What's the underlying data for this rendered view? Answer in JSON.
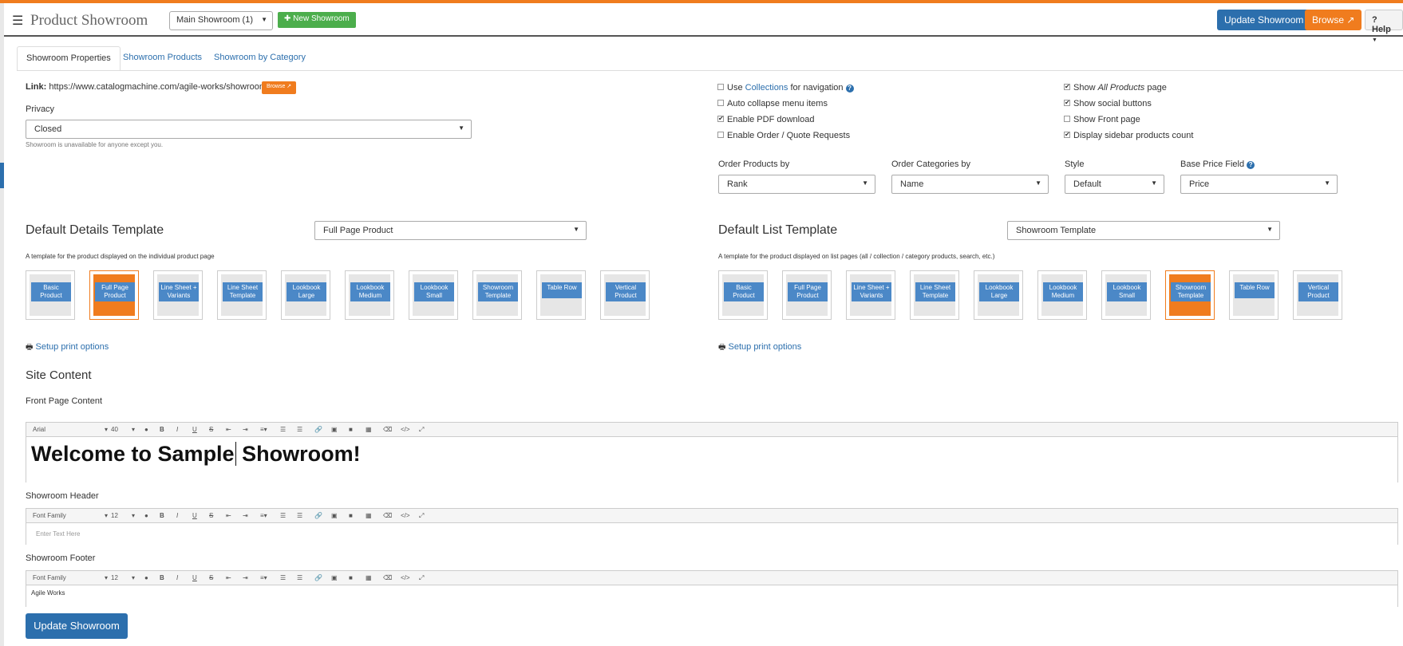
{
  "navbar": {
    "brand": "Product Showroom",
    "showroom_select": "Main Showroom (1)",
    "new_button": "New Showroom",
    "update_button": "Update Showroom",
    "browse_button": "Browse",
    "help_button": "Help"
  },
  "tabs": [
    "Showroom Properties",
    "Showroom Products",
    "Showroom by Category"
  ],
  "link": {
    "label": "Link:",
    "url": "https://www.catalogmachine.com/agile-works/showroom/",
    "browse": "Browse"
  },
  "privacy": {
    "label": "Privacy",
    "value": "Closed",
    "help": "Showroom is unavailable for anyone except you."
  },
  "options_left": {
    "use_prefix": "Use",
    "collections_link": "Collections",
    "use_suffix": "for navigation",
    "auto_collapse": "Auto collapse menu items",
    "enable_pdf": "Enable PDF download",
    "enable_order": "Enable Order / Quote Requests"
  },
  "options_right": {
    "show_all_prefix": "Show",
    "show_all_italic": "All Products",
    "show_all_suffix": "page",
    "show_social": "Show social buttons",
    "show_front": "Show Front page",
    "display_sidebar": "Display sidebar products count"
  },
  "checked": {
    "use_collections": false,
    "auto_collapse": false,
    "enable_pdf": true,
    "enable_order": false,
    "show_all": true,
    "show_social": true,
    "show_front": false,
    "display_sidebar": true
  },
  "order_fields": [
    {
      "label": "Order Products by",
      "value": "Rank"
    },
    {
      "label": "Order Categories by",
      "value": "Name"
    },
    {
      "label": "Style",
      "value": "Default"
    },
    {
      "label": "Base Price Field",
      "value": "Price"
    }
  ],
  "details_template": {
    "title": "Default Details Template",
    "select": "Full Page Product",
    "desc": "A template for the product displayed on the individual product page",
    "selected": "Full Page Product",
    "print": "Setup print options"
  },
  "list_template": {
    "title": "Default List Template",
    "select": "Showroom Template",
    "desc": "A template for the product displayed on list pages (all / collection / category products, search, etc.)",
    "selected": "Showroom Template",
    "print": "Setup print options"
  },
  "templates": [
    "Basic Product",
    "Full Page Product",
    "Line Sheet + Variants",
    "Line Sheet Template",
    "Lookbook Large",
    "Lookbook Medium",
    "Lookbook Small",
    "Showroom Template",
    "Table Row",
    "Vertical Product"
  ],
  "site_content": {
    "title": "Site Content",
    "front_label": "Front Page Content",
    "front_font": "Arial",
    "front_size": "40",
    "front_text_before": "Welcome to Sample",
    "front_text_after": " Showroom!",
    "header_label": "Showroom Header",
    "header_font": "Font Family",
    "header_size": "12",
    "header_placeholder": "Enter Text Here",
    "footer_label": "Showroom Footer",
    "footer_font": "Font Family",
    "footer_size": "12",
    "footer_text": "Agile Works"
  },
  "bottom_button": "Update Showroom",
  "colors": {
    "orange": "#f07c1e",
    "blue": "#2c6fad",
    "green": "#4cae4c"
  }
}
